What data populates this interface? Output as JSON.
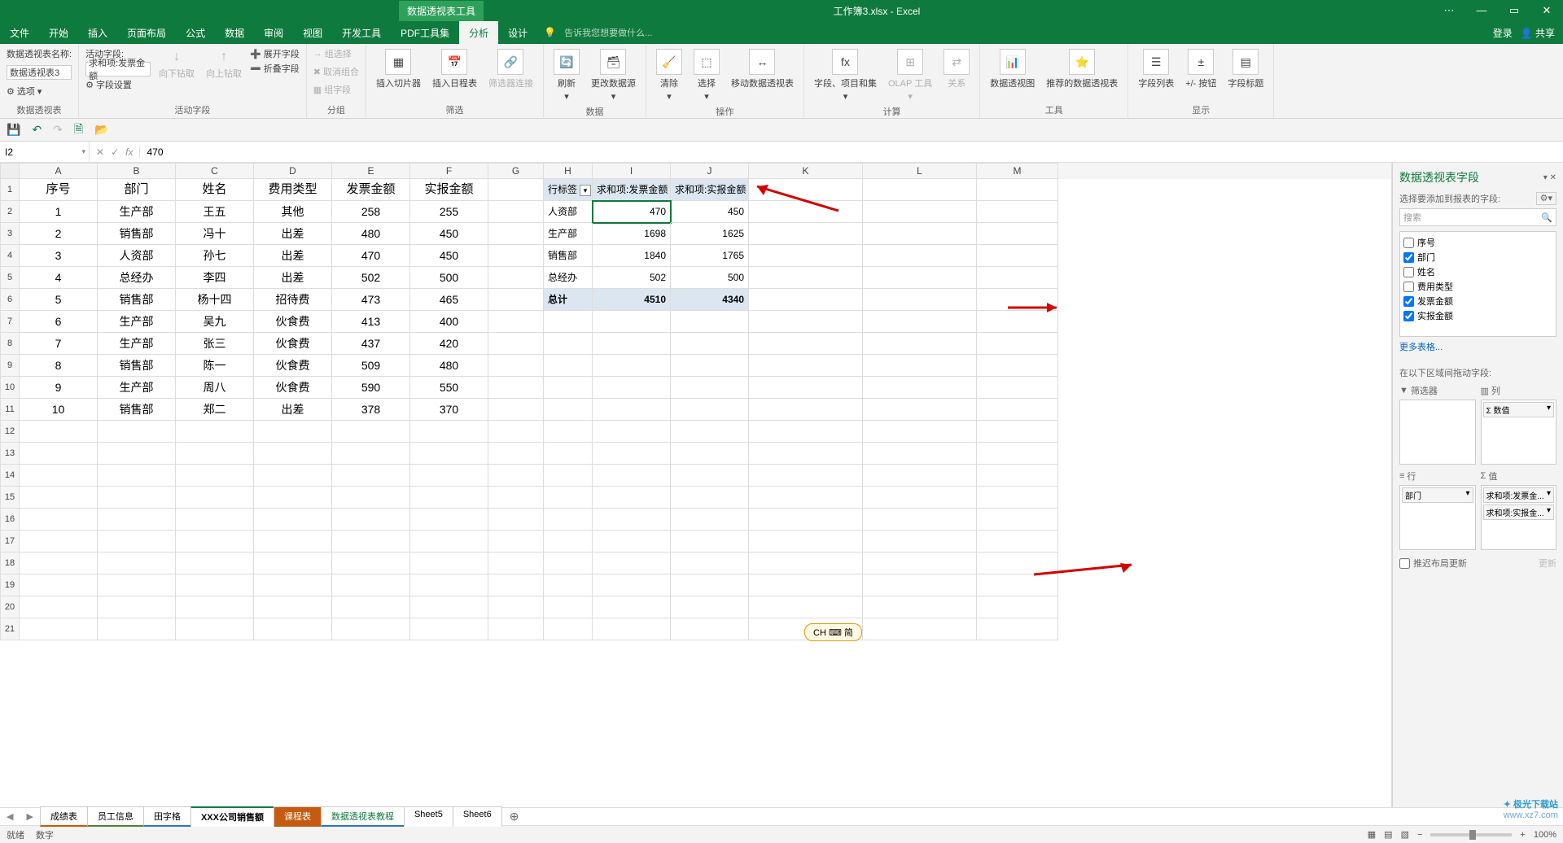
{
  "title_context": "数据透视表工具",
  "title_doc": "工作簿3.xlsx - Excel",
  "win": {
    "ribbon_opts": "⋯",
    "min": "—",
    "max": "▭",
    "close": "✕"
  },
  "tabs": [
    "文件",
    "开始",
    "插入",
    "页面布局",
    "公式",
    "数据",
    "审阅",
    "视图",
    "开发工具",
    "PDF工具集",
    "分析",
    "设计"
  ],
  "active_tab": 10,
  "tell_me": "告诉我您想要做什么...",
  "account": {
    "login": "登录",
    "share": "共享"
  },
  "ribbon": {
    "g1": {
      "label": "数据透视表",
      "name_lbl": "数据透视表名称:",
      "name_val": "数据透视表3",
      "opts": "选项"
    },
    "g2": {
      "label": "活动字段",
      "afl": "活动字段:",
      "af_val": "求和项:发票金额",
      "fs": "字段设置",
      "dd": "向下钻取",
      "du": "向上钻取",
      "ef": "展开字段",
      "cf": "折叠字段"
    },
    "g3": {
      "label": "分组",
      "gs": "组选择",
      "ug": "取消组合",
      "gf": "组字段"
    },
    "g4": {
      "label": "筛选",
      "sl": "插入切片器",
      "tl": "插入日程表",
      "fc": "筛选器连接"
    },
    "g5": {
      "label": "数据",
      "rf": "刷新",
      "cd": "更改数据源"
    },
    "g6": {
      "label": "操作",
      "cl": "清除",
      "se": "选择",
      "mv": "移动数据透视表"
    },
    "g7": {
      "label": "计算",
      "fi": "字段、项目和集",
      "ol": "OLAP 工具",
      "re": "关系"
    },
    "g8": {
      "label": "工具",
      "pc": "数据透视图",
      "rp": "推荐的数据透视表"
    },
    "g9": {
      "label": "显示",
      "fl": "字段列表",
      "pm": "+/- 按钮",
      "fh": "字段标题"
    }
  },
  "formula": {
    "cell_ref": "I2",
    "value": "470"
  },
  "columns": [
    "A",
    "B",
    "C",
    "D",
    "E",
    "F",
    "G",
    "H",
    "I",
    "J",
    "K",
    "L",
    "M"
  ],
  "data_headers": [
    "序号",
    "部门",
    "姓名",
    "费用类型",
    "发票金额",
    "实报金额"
  ],
  "data_rows": [
    [
      "1",
      "生产部",
      "王五",
      "其他",
      "258",
      "255"
    ],
    [
      "2",
      "销售部",
      "冯十",
      "出差",
      "480",
      "450"
    ],
    [
      "3",
      "人资部",
      "孙七",
      "出差",
      "470",
      "450"
    ],
    [
      "4",
      "总经办",
      "李四",
      "出差",
      "502",
      "500"
    ],
    [
      "5",
      "销售部",
      "杨十四",
      "招待费",
      "473",
      "465"
    ],
    [
      "6",
      "生产部",
      "吴九",
      "伙食费",
      "413",
      "400"
    ],
    [
      "7",
      "生产部",
      "张三",
      "伙食费",
      "437",
      "420"
    ],
    [
      "8",
      "销售部",
      "陈一",
      "伙食费",
      "509",
      "480"
    ],
    [
      "9",
      "生产部",
      "周八",
      "伙食费",
      "590",
      "550"
    ],
    [
      "10",
      "销售部",
      "郑二",
      "出差",
      "378",
      "370"
    ]
  ],
  "pivot": {
    "headers": [
      "行标签",
      "求和项:发票金额",
      "求和项:实报金额"
    ],
    "rows": [
      [
        "人资部",
        "470",
        "450"
      ],
      [
        "生产部",
        "1698",
        "1625"
      ],
      [
        "销售部",
        "1840",
        "1765"
      ],
      [
        "总经办",
        "502",
        "500"
      ]
    ],
    "total_label": "总计",
    "totals": [
      "4510",
      "4340"
    ]
  },
  "field_pane": {
    "title": "数据透视表字段",
    "subtitle": "选择要添加到报表的字段:",
    "search_ph": "搜索",
    "fields": [
      {
        "name": "序号",
        "checked": false
      },
      {
        "name": "部门",
        "checked": true
      },
      {
        "name": "姓名",
        "checked": false
      },
      {
        "name": "费用类型",
        "checked": false
      },
      {
        "name": "发票金额",
        "checked": true
      },
      {
        "name": "实报金额",
        "checked": true
      }
    ],
    "more": "更多表格...",
    "areas_hdr": "在以下区域间拖动字段:",
    "filter": "筛选器",
    "cols": "列",
    "rows_l": "行",
    "vals": "值",
    "col_items": [
      "数值"
    ],
    "row_items": [
      "部门"
    ],
    "val_items": [
      "求和项:发票金...",
      "求和项:实报金..."
    ],
    "defer": "推迟布局更新",
    "update": "更新"
  },
  "sheets": [
    "成绩表",
    "员工信息",
    "田字格",
    "XXX公司销售额",
    "课程表",
    "数据透视表教程",
    "Sheet5",
    "Sheet6"
  ],
  "active_sheet": 3,
  "status": {
    "ready": "就绪",
    "num": "数字",
    "zoom": "100%"
  },
  "ime": "CH ⌨ 简",
  "watermark": {
    "brand": "极光下载站",
    "url": "www.xz7.com"
  }
}
